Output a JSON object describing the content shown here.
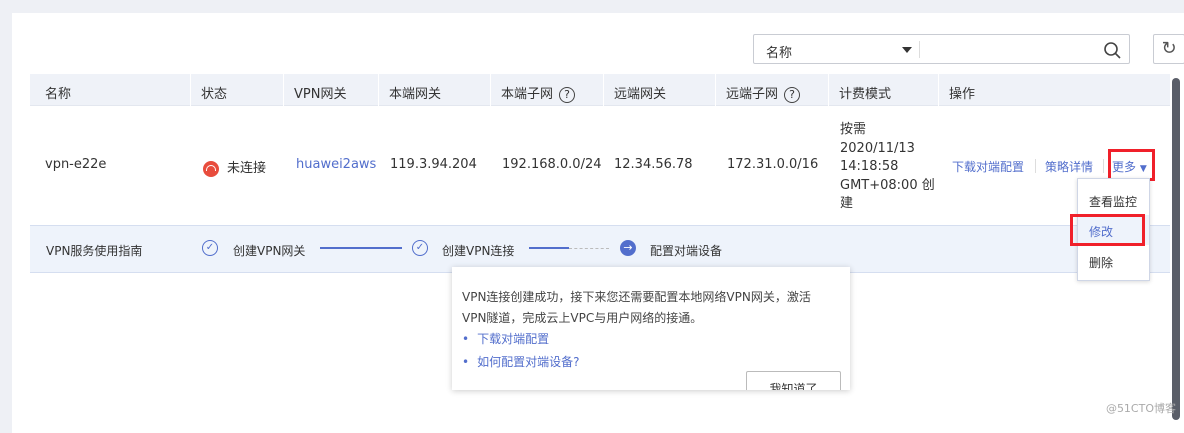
{
  "search": {
    "field": "名称",
    "value": ""
  },
  "columns": [
    "名称",
    "状态",
    "VPN网关",
    "本端网关",
    "本端子网",
    "远端网关",
    "远端子网",
    "计费模式",
    "操作"
  ],
  "row": {
    "name": "vpn-e22e",
    "status": "未连接",
    "vpn_gateway": "huawei2aws",
    "local_gateway": "119.3.94.204",
    "local_subnet": "192.168.0.0/24",
    "remote_gateway": "12.34.56.78",
    "remote_subnet": "172.31.0.0/16",
    "billing": [
      "按需",
      "2020/11/13",
      "14:18:58",
      "GMT+08:00 创",
      "建"
    ],
    "actions": {
      "download": "下载对端配置",
      "policy": "策略详情",
      "more": "更多"
    }
  },
  "more_menu": [
    "查看监控",
    "修改",
    "删除"
  ],
  "guide": {
    "title": "VPN服务使用指南",
    "steps": [
      "创建VPN网关",
      "创建VPN连接",
      "配置对端设备"
    ]
  },
  "popover": {
    "text1": "VPN连接创建成功，接下来您还需要配置本地网络VPN网关，激活",
    "text2": "VPN隧道，完成云上VPC与用户网络的接通。",
    "link1": "下载对端配置",
    "link2": "如何配置对端设备?",
    "button": "我知道了"
  },
  "watermark": "@51CTO博客",
  "colors": {
    "accent": "#526ecc",
    "error": "#e84c3d",
    "highlight": "#f0202a"
  }
}
